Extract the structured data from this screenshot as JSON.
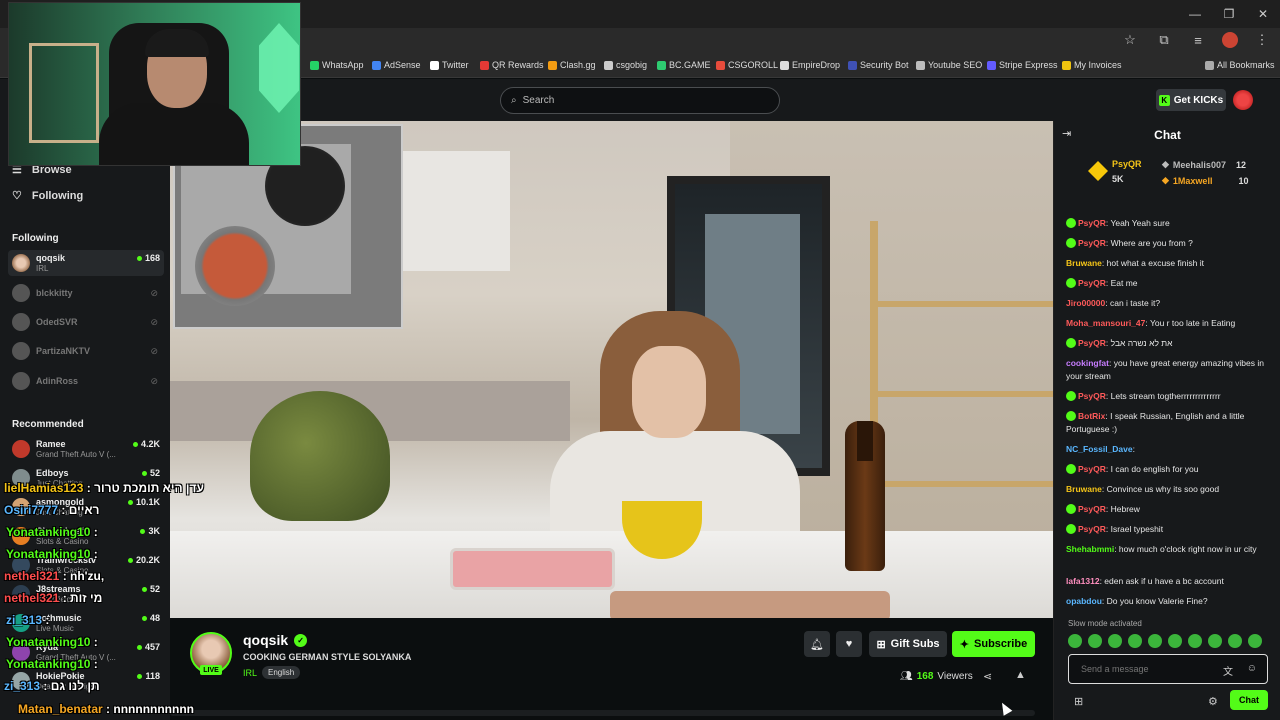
{
  "colors": {
    "accent": "#53fc18",
    "bg": "#0b0e0f",
    "panel": "#17191b"
  },
  "bookmarks": [
    {
      "label": "WhatsApp",
      "color": "#25d366"
    },
    {
      "label": "AdSense",
      "color": "#4285f4"
    },
    {
      "label": "Twitter",
      "color": "#ffffff"
    },
    {
      "label": "QR Rewards",
      "color": "#e53935"
    },
    {
      "label": "Clash.gg",
      "color": "#f39c12"
    },
    {
      "label": "csgobig",
      "color": "#cccccc"
    },
    {
      "label": "BC.GAME",
      "color": "#2ecc71"
    },
    {
      "label": "CSGOROLL",
      "color": "#e74c3c"
    },
    {
      "label": "EmpireDrop",
      "color": "#dddddd"
    },
    {
      "label": "Security Bot",
      "color": "#3f51b5"
    },
    {
      "label": "Youtube SEO",
      "color": "#bbbbbb"
    },
    {
      "label": "Stripe Express",
      "color": "#635bff"
    },
    {
      "label": "My Invoices",
      "color": "#f1c40f"
    },
    {
      "label": "All Bookmarks",
      "color": "#aaaaaa"
    }
  ],
  "topbar": {
    "search_placeholder": "Search",
    "get_kicks": "Get KICKs"
  },
  "sidebar": {
    "nav": [
      {
        "label": "Browse"
      },
      {
        "label": "Following"
      }
    ],
    "following_heading": "Following",
    "following": [
      {
        "name": "qoqsik",
        "category": "IRL",
        "viewers": "168",
        "live": true
      },
      {
        "name": "blckkitty",
        "live": false
      },
      {
        "name": "OdedSVR",
        "live": false
      },
      {
        "name": "PartizaNKTV",
        "live": false
      },
      {
        "name": "AdinRoss",
        "live": false
      }
    ],
    "recommended_heading": "Recommended",
    "recommended": [
      {
        "name": "Ramee",
        "category": "Grand Theft Auto V (...",
        "viewers": "4.2K"
      },
      {
        "name": "Edboys",
        "category": "Just Chatting",
        "viewers": "52"
      },
      {
        "name": "asmongold",
        "category": "Just Chatting",
        "viewers": "10.1K"
      },
      {
        "name": "Classybeef",
        "category": "Slots & Casino",
        "viewers": "3K"
      },
      {
        "name": "Trainwreckstv",
        "category": "Slots & Casino",
        "viewers": "20.2K"
      },
      {
        "name": "J8streams",
        "category": "Battlefield 6",
        "viewers": "52"
      },
      {
        "name": "gothmusic",
        "category": "Live Music",
        "viewers": "48"
      },
      {
        "name": "Ryda",
        "category": "Grand Theft Auto V (...",
        "viewers": "457"
      },
      {
        "name": "HokiePokie",
        "category": "Dead by Daylight",
        "viewers": "118"
      }
    ]
  },
  "stream": {
    "streamer": "qoqsik",
    "title": "COOKING GERMAN STYLE SOLYANKA",
    "category": "IRL",
    "tag": "English",
    "live_label": "LIVE",
    "gift_subs": "Gift Subs",
    "subscribe": "Subscribe",
    "viewers": "168",
    "viewers_label": "Viewers"
  },
  "overlay_chat": [
    {
      "user": "lielHamias123",
      "text": " : עדן היא תומכת טרור",
      "color": "#f5c518"
    },
    {
      "user": "Osiri7777",
      "text": " : ראיים",
      "color": "#5ab7ff"
    },
    {
      "user": "Yonatanking10",
      "text": " :",
      "color": "#53fc18"
    },
    {
      "user": "Yonatanking10",
      "text": " :",
      "color": "#53fc18"
    },
    {
      "user": "nethel321",
      "text": " : nh'zu,",
      "color": "#ff4d4d"
    },
    {
      "user": "nethel321",
      "text": " : מי זות",
      "color": "#ff4d4d"
    },
    {
      "user": "zi_313",
      "text": " :",
      "color": "#5ab7ff"
    },
    {
      "user": "Yonatanking10",
      "text": " :",
      "color": "#53fc18"
    },
    {
      "user": "Yonatanking10",
      "text": " :",
      "color": "#53fc18"
    },
    {
      "user": "zi_313",
      "text": " : תן לנו גם",
      "color": "#5ab7ff"
    },
    {
      "user": "Matan_benatar",
      "text": " : nnnnnnnnnnn",
      "color": "#f5a623"
    }
  ],
  "chat": {
    "title": "Chat",
    "top_gifters": [
      {
        "name": "PsyQR",
        "amount": "5K",
        "color": "#f5c518"
      },
      {
        "name": "Meehalis007",
        "amount": "12",
        "color": "#bbbbbb"
      },
      {
        "name": "1Maxwell",
        "amount": "10",
        "color": "#f5a623"
      }
    ],
    "messages": [
      {
        "user": "PsyQR",
        "color": "#ff5a5a",
        "badge": true,
        "text": "Yeah Yeah sure"
      },
      {
        "user": "PsyQR",
        "color": "#ff5a5a",
        "badge": true,
        "text": "Where are you from ?"
      },
      {
        "user": "Bruwane",
        "color": "#f5c518",
        "badge": false,
        "text": "hot what a excuse      finish it"
      },
      {
        "user": "PsyQR",
        "color": "#ff5a5a",
        "badge": true,
        "text": "Eat me"
      },
      {
        "user": "Jiro00000",
        "color": "#ff5a5a",
        "badge": false,
        "text": "can i taste it?"
      },
      {
        "user": "Moha_mansouri_47",
        "color": "#ff5a5a",
        "badge": false,
        "text": "You r too late in Eating"
      },
      {
        "user": "PsyQR",
        "color": "#ff5a5a",
        "badge": true,
        "text": "את לא נשרה אבל"
      },
      {
        "user": "cookingfat",
        "color": "#c77dff",
        "badge": false,
        "text": "you have great energy amazing vibes in your stream"
      },
      {
        "user": "PsyQR",
        "color": "#ff5a5a",
        "badge": true,
        "text": "Lets stream togtherrrrrrrrrrrrrr"
      },
      {
        "user": "BotRix",
        "color": "#ff5a5a",
        "badge": true,
        "text": "I speak Russian, English and a little Portuguese :)"
      },
      {
        "user": "NC_Fossil_Dave",
        "color": "#5ab7ff",
        "badge": false,
        "text": ""
      },
      {
        "user": "PsyQR",
        "color": "#ff5a5a",
        "badge": true,
        "text": "I can do english for you"
      },
      {
        "user": "Bruwane",
        "color": "#f5c518",
        "badge": false,
        "text": "Convince us why its soo good"
      },
      {
        "user": "PsyQR",
        "color": "#ff5a5a",
        "badge": true,
        "text": "Hebrew"
      },
      {
        "user": "PsyQR",
        "color": "#ff5a5a",
        "badge": true,
        "text": "Israel typeshit"
      },
      {
        "user": "Shehabmmi",
        "color": "#53fc18",
        "badge": false,
        "text": "how much o'clock right now in ur city"
      },
      {
        "user": "lafa1312",
        "color": "#ff8fbf",
        "badge": false,
        "text": "eden ask if u have a bc account"
      },
      {
        "user": "opabdou",
        "color": "#5ab7ff",
        "badge": false,
        "text": "Do you know Valerie Fine?"
      }
    ],
    "slow_mode": "Slow mode activated",
    "input_placeholder": "Send a message",
    "send_label": "Chat"
  }
}
